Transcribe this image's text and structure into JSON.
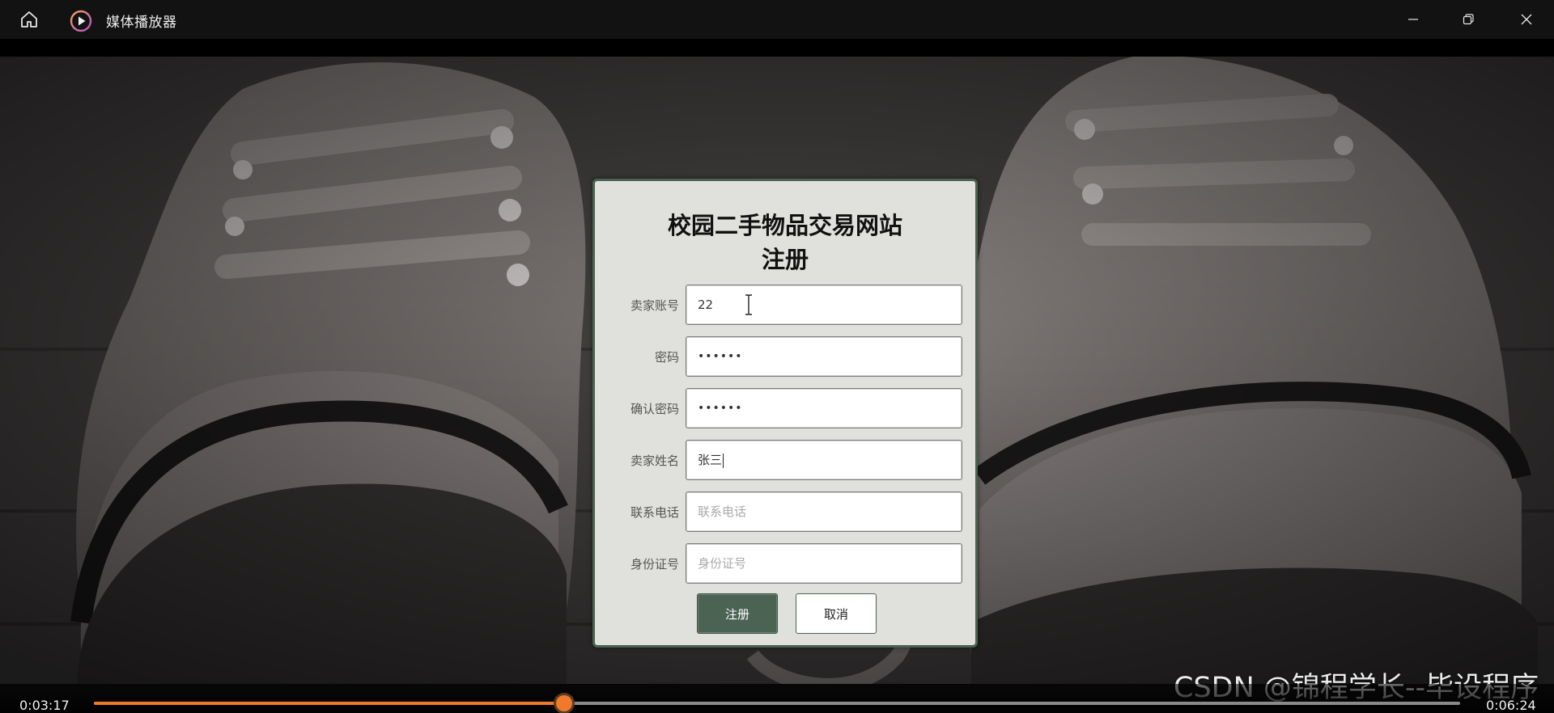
{
  "window": {
    "title": "媒体播放器",
    "icons": {
      "home": "home-icon",
      "app": "play-circle-icon",
      "minimize": "minimize-icon",
      "maximize": "restore-icon",
      "close": "close-icon"
    }
  },
  "form": {
    "title": "校园二手物品交易网站",
    "subtitle": "注册",
    "fields": [
      {
        "label": "卖家账号",
        "value": "22",
        "placeholder": "",
        "type": "text"
      },
      {
        "label": "密码",
        "value": "••••••",
        "placeholder": "",
        "type": "password"
      },
      {
        "label": "确认密码",
        "value": "••••••",
        "placeholder": "",
        "type": "password"
      },
      {
        "label": "卖家姓名",
        "value": "张三",
        "placeholder": "",
        "type": "text"
      },
      {
        "label": "联系电话",
        "value": "",
        "placeholder": "联系电话",
        "type": "text"
      },
      {
        "label": "身份证号",
        "value": "",
        "placeholder": "身份证号",
        "type": "text"
      }
    ],
    "submit_label": "注册",
    "cancel_label": "取消"
  },
  "player": {
    "current_time": "0:03:17",
    "total_time": "0:06:24",
    "progress_fraction": 0.344
  },
  "watermark": "CSDN @锦程学长--毕设程序",
  "colors": {
    "accent": "#f07a2c",
    "form_primary": "#4a6352",
    "card_border": "#4b6251"
  }
}
